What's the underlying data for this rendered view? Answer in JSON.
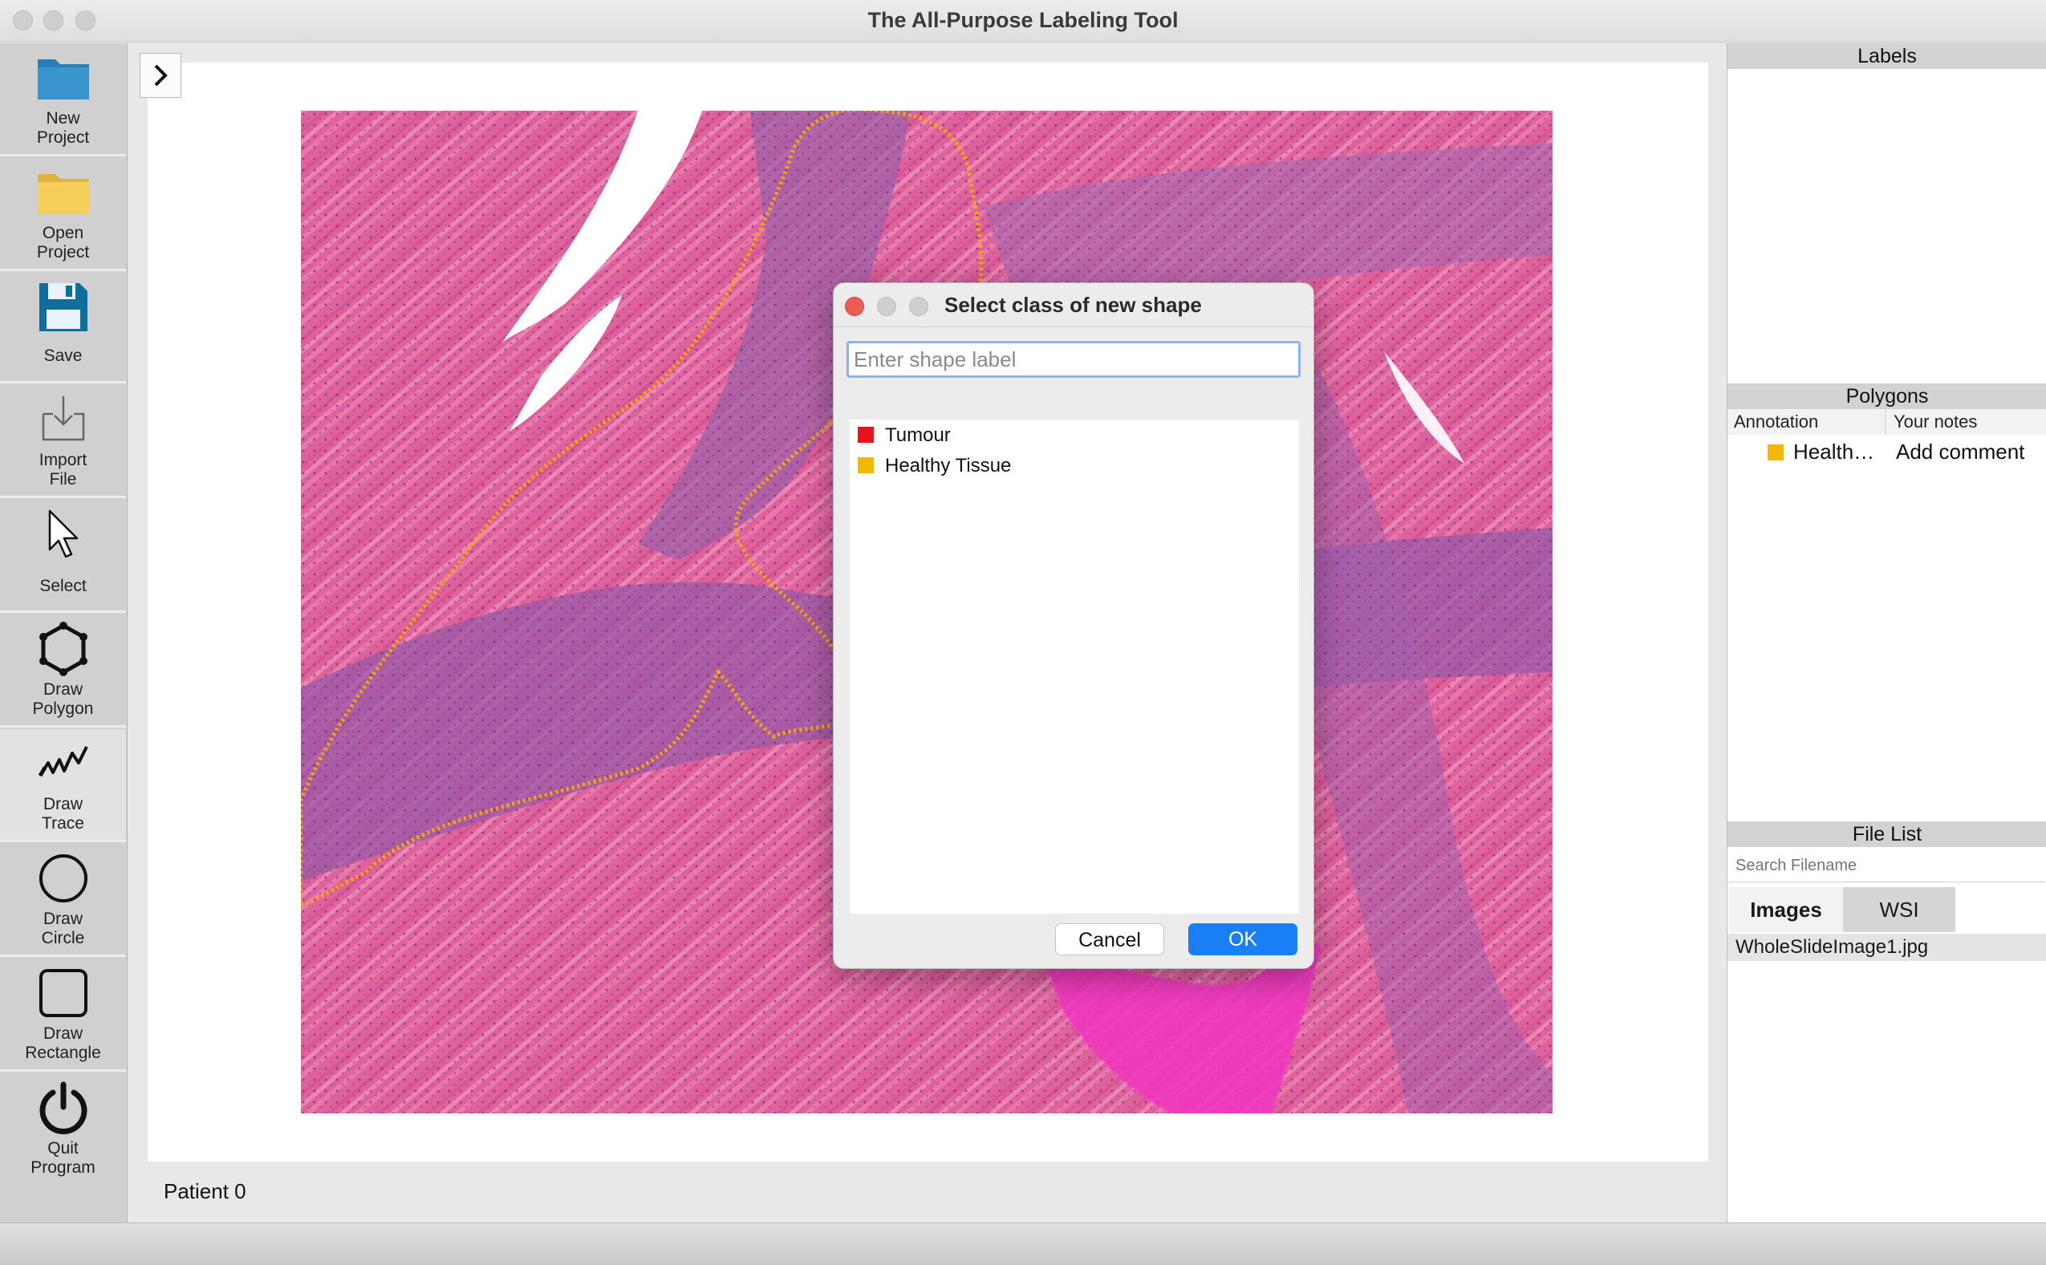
{
  "window": {
    "title": "The All-Purpose Labeling Tool"
  },
  "toolbar": {
    "items": [
      {
        "label": "New\nProject",
        "icon": "folder-blue-icon"
      },
      {
        "label": "Open\nProject",
        "icon": "folder-yellow-icon"
      },
      {
        "label": "Save",
        "icon": "floppy-disk-icon"
      },
      {
        "label": "Import\nFile",
        "icon": "import-file-icon"
      },
      {
        "label": "Select",
        "icon": "cursor-arrow-icon"
      },
      {
        "label": "Draw\nPolygon",
        "icon": "polygon-icon"
      },
      {
        "label": "Draw\nTrace",
        "icon": "trace-icon",
        "active": true
      },
      {
        "label": "Draw\nCircle",
        "icon": "circle-icon"
      },
      {
        "label": "Draw\nRectangle",
        "icon": "rectangle-icon"
      },
      {
        "label": "Quit\nProgram",
        "icon": "power-icon"
      }
    ]
  },
  "canvas": {
    "status_text": "Patient 0"
  },
  "right_panel": {
    "labels_header": "Labels",
    "polygons_header": "Polygons",
    "polygons_columns": [
      "Annotation",
      "Your notes"
    ],
    "polygons_rows": [
      {
        "annotation": "Health…",
        "color": "#f5b800",
        "note": "Add comment"
      }
    ],
    "file_list_header": "File List",
    "search_placeholder": "Search Filename",
    "tabs": [
      {
        "label": "Images",
        "active": true
      },
      {
        "label": "WSI",
        "active": false
      }
    ],
    "files": [
      "WholeSlideImage1.jpg"
    ]
  },
  "dialog": {
    "title": "Select class of new shape",
    "input_placeholder": "Enter shape label",
    "classes": [
      {
        "name": "Tumour",
        "color": "#e8131b"
      },
      {
        "name": "Healthy Tissue",
        "color": "#f5b800"
      }
    ],
    "cancel_label": "Cancel",
    "ok_label": "OK"
  },
  "colors": {
    "accent": "#1a7ef5",
    "healthy_outline": "#f5a800",
    "tumour_outline": "#ff33cc"
  }
}
